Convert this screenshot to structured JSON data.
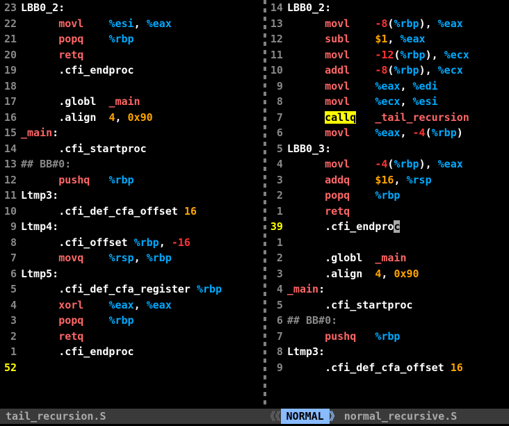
{
  "left": {
    "filename": "tail_recursion.S",
    "lines": [
      {
        "n": "23",
        "tokens": [
          {
            "cls": "c-label",
            "t": "LBB0_2:"
          }
        ]
      },
      {
        "n": "22",
        "tokens": [
          {
            "cls": "c-white",
            "t": "      "
          },
          {
            "cls": "c-op",
            "t": "movl"
          },
          {
            "cls": "c-white",
            "t": "    "
          },
          {
            "cls": "c-reg",
            "t": "%esi"
          },
          {
            "cls": "c-white",
            "t": ", "
          },
          {
            "cls": "c-reg",
            "t": "%eax"
          }
        ]
      },
      {
        "n": "21",
        "tokens": [
          {
            "cls": "c-white",
            "t": "      "
          },
          {
            "cls": "c-op",
            "t": "popq"
          },
          {
            "cls": "c-white",
            "t": "    "
          },
          {
            "cls": "c-reg",
            "t": "%rbp"
          }
        ]
      },
      {
        "n": "20",
        "tokens": [
          {
            "cls": "c-white",
            "t": "      "
          },
          {
            "cls": "c-op",
            "t": "retq"
          }
        ]
      },
      {
        "n": "19",
        "tokens": [
          {
            "cls": "c-white",
            "t": "      "
          },
          {
            "cls": "c-dir",
            "t": ".cfi_endproc"
          }
        ]
      },
      {
        "n": "18",
        "tokens": [
          {
            "cls": "c-white",
            "t": " "
          }
        ]
      },
      {
        "n": "17",
        "tokens": [
          {
            "cls": "c-white",
            "t": "      "
          },
          {
            "cls": "c-dir",
            "t": ".globl"
          },
          {
            "cls": "c-white",
            "t": "  "
          },
          {
            "cls": "c-sym",
            "t": "_main"
          }
        ]
      },
      {
        "n": "16",
        "tokens": [
          {
            "cls": "c-white",
            "t": "      "
          },
          {
            "cls": "c-dir",
            "t": ".align"
          },
          {
            "cls": "c-white",
            "t": "  "
          },
          {
            "cls": "c-num",
            "t": "4"
          },
          {
            "cls": "c-white",
            "t": ", "
          },
          {
            "cls": "c-num",
            "t": "0x90"
          }
        ]
      },
      {
        "n": "15",
        "tokens": [
          {
            "cls": "c-sym",
            "t": "_main"
          },
          {
            "cls": "c-white",
            "t": ":"
          }
        ]
      },
      {
        "n": "14",
        "tokens": [
          {
            "cls": "c-white",
            "t": "      "
          },
          {
            "cls": "c-dir",
            "t": ".cfi_startproc"
          }
        ]
      },
      {
        "n": "13",
        "tokens": [
          {
            "cls": "c-cmt",
            "t": "## BB#0:"
          }
        ]
      },
      {
        "n": "12",
        "tokens": [
          {
            "cls": "c-white",
            "t": "      "
          },
          {
            "cls": "c-op",
            "t": "pushq"
          },
          {
            "cls": "c-white",
            "t": "   "
          },
          {
            "cls": "c-reg",
            "t": "%rbp"
          }
        ]
      },
      {
        "n": "11",
        "tokens": [
          {
            "cls": "c-label",
            "t": "Ltmp3:"
          }
        ]
      },
      {
        "n": "10",
        "tokens": [
          {
            "cls": "c-white",
            "t": "      "
          },
          {
            "cls": "c-dir",
            "t": ".cfi_def_cfa_offset"
          },
          {
            "cls": "c-white",
            "t": " "
          },
          {
            "cls": "c-num",
            "t": "16"
          }
        ]
      },
      {
        "n": "9",
        "tokens": [
          {
            "cls": "c-label",
            "t": "Ltmp4:"
          }
        ]
      },
      {
        "n": "8",
        "tokens": [
          {
            "cls": "c-white",
            "t": "      "
          },
          {
            "cls": "c-dir",
            "t": ".cfi_offset"
          },
          {
            "cls": "c-white",
            "t": " "
          },
          {
            "cls": "c-reg",
            "t": "%rbp"
          },
          {
            "cls": "c-white",
            "t": ", "
          },
          {
            "cls": "c-num2",
            "t": "-16"
          }
        ]
      },
      {
        "n": "7",
        "tokens": [
          {
            "cls": "c-white",
            "t": "      "
          },
          {
            "cls": "c-op",
            "t": "movq"
          },
          {
            "cls": "c-white",
            "t": "    "
          },
          {
            "cls": "c-reg",
            "t": "%rsp"
          },
          {
            "cls": "c-white",
            "t": ", "
          },
          {
            "cls": "c-reg",
            "t": "%rbp"
          }
        ]
      },
      {
        "n": "6",
        "tokens": [
          {
            "cls": "c-label",
            "t": "Ltmp5:"
          }
        ]
      },
      {
        "n": "5",
        "tokens": [
          {
            "cls": "c-white",
            "t": "      "
          },
          {
            "cls": "c-dir",
            "t": ".cfi_def_cfa_register"
          },
          {
            "cls": "c-white",
            "t": " "
          },
          {
            "cls": "c-reg",
            "t": "%rbp"
          }
        ]
      },
      {
        "n": "4",
        "tokens": [
          {
            "cls": "c-white",
            "t": "      "
          },
          {
            "cls": "c-op",
            "t": "xorl"
          },
          {
            "cls": "c-white",
            "t": "    "
          },
          {
            "cls": "c-reg",
            "t": "%eax"
          },
          {
            "cls": "c-white",
            "t": ", "
          },
          {
            "cls": "c-reg",
            "t": "%eax"
          }
        ]
      },
      {
        "n": "3",
        "tokens": [
          {
            "cls": "c-white",
            "t": "      "
          },
          {
            "cls": "c-op",
            "t": "popq"
          },
          {
            "cls": "c-white",
            "t": "    "
          },
          {
            "cls": "c-reg",
            "t": "%rbp"
          }
        ]
      },
      {
        "n": "2",
        "tokens": [
          {
            "cls": "c-white",
            "t": "      "
          },
          {
            "cls": "c-op",
            "t": "retq"
          }
        ]
      },
      {
        "n": "1",
        "tokens": [
          {
            "cls": "c-white",
            "t": "      "
          },
          {
            "cls": "c-dir",
            "t": ".cfi_endproc"
          }
        ]
      },
      {
        "n": "52",
        "cur": true,
        "tokens": [
          {
            "cls": "c-white",
            "t": " "
          }
        ]
      }
    ]
  },
  "right": {
    "filename": "normal_recursive.S",
    "mode": "NORMAL",
    "lines": [
      {
        "n": "14",
        "tokens": [
          {
            "cls": "c-label",
            "t": "LBB0_2:"
          }
        ]
      },
      {
        "n": "13",
        "tokens": [
          {
            "cls": "c-white",
            "t": "      "
          },
          {
            "cls": "c-op",
            "t": "movl"
          },
          {
            "cls": "c-white",
            "t": "    "
          },
          {
            "cls": "c-num2",
            "t": "-8"
          },
          {
            "cls": "c-white",
            "t": "("
          },
          {
            "cls": "c-reg",
            "t": "%rbp"
          },
          {
            "cls": "c-white",
            "t": "), "
          },
          {
            "cls": "c-reg",
            "t": "%eax"
          }
        ]
      },
      {
        "n": "12",
        "tokens": [
          {
            "cls": "c-white",
            "t": "      "
          },
          {
            "cls": "c-op",
            "t": "subl"
          },
          {
            "cls": "c-white",
            "t": "    "
          },
          {
            "cls": "c-num",
            "t": "$1"
          },
          {
            "cls": "c-white",
            "t": ", "
          },
          {
            "cls": "c-reg",
            "t": "%eax"
          }
        ]
      },
      {
        "n": "11",
        "tokens": [
          {
            "cls": "c-white",
            "t": "      "
          },
          {
            "cls": "c-op",
            "t": "movl"
          },
          {
            "cls": "c-white",
            "t": "    "
          },
          {
            "cls": "c-num2",
            "t": "-12"
          },
          {
            "cls": "c-white",
            "t": "("
          },
          {
            "cls": "c-reg",
            "t": "%rbp"
          },
          {
            "cls": "c-white",
            "t": "), "
          },
          {
            "cls": "c-reg",
            "t": "%ecx"
          }
        ]
      },
      {
        "n": "10",
        "tokens": [
          {
            "cls": "c-white",
            "t": "      "
          },
          {
            "cls": "c-op",
            "t": "addl"
          },
          {
            "cls": "c-white",
            "t": "    "
          },
          {
            "cls": "c-num2",
            "t": "-8"
          },
          {
            "cls": "c-white",
            "t": "("
          },
          {
            "cls": "c-reg",
            "t": "%rbp"
          },
          {
            "cls": "c-white",
            "t": "), "
          },
          {
            "cls": "c-reg",
            "t": "%ecx"
          }
        ]
      },
      {
        "n": "9",
        "tokens": [
          {
            "cls": "c-white",
            "t": "      "
          },
          {
            "cls": "c-op",
            "t": "movl"
          },
          {
            "cls": "c-white",
            "t": "    "
          },
          {
            "cls": "c-reg",
            "t": "%eax"
          },
          {
            "cls": "c-white",
            "t": ", "
          },
          {
            "cls": "c-reg",
            "t": "%edi"
          }
        ]
      },
      {
        "n": "8",
        "tokens": [
          {
            "cls": "c-white",
            "t": "      "
          },
          {
            "cls": "c-op",
            "t": "movl"
          },
          {
            "cls": "c-white",
            "t": "    "
          },
          {
            "cls": "c-reg",
            "t": "%ecx"
          },
          {
            "cls": "c-white",
            "t": ", "
          },
          {
            "cls": "c-reg",
            "t": "%esi"
          }
        ]
      },
      {
        "n": "7",
        "tokens": [
          {
            "cls": "c-white",
            "t": "      "
          },
          {
            "cls": "hl-call",
            "t": "callq"
          },
          {
            "cls": "c-white",
            "t": "   "
          },
          {
            "cls": "c-sym",
            "t": "_tail_recursion"
          }
        ]
      },
      {
        "n": "6",
        "tokens": [
          {
            "cls": "c-white",
            "t": "      "
          },
          {
            "cls": "c-op",
            "t": "movl"
          },
          {
            "cls": "c-white",
            "t": "    "
          },
          {
            "cls": "c-reg",
            "t": "%eax"
          },
          {
            "cls": "c-white",
            "t": ", "
          },
          {
            "cls": "c-num2",
            "t": "-4"
          },
          {
            "cls": "c-white",
            "t": "("
          },
          {
            "cls": "c-reg",
            "t": "%rbp"
          },
          {
            "cls": "c-white",
            "t": ")"
          }
        ]
      },
      {
        "n": "5",
        "tokens": [
          {
            "cls": "c-label",
            "t": "LBB0_3:"
          }
        ]
      },
      {
        "n": "4",
        "tokens": [
          {
            "cls": "c-white",
            "t": "      "
          },
          {
            "cls": "c-op",
            "t": "movl"
          },
          {
            "cls": "c-white",
            "t": "    "
          },
          {
            "cls": "c-num2",
            "t": "-4"
          },
          {
            "cls": "c-white",
            "t": "("
          },
          {
            "cls": "c-reg",
            "t": "%rbp"
          },
          {
            "cls": "c-white",
            "t": "), "
          },
          {
            "cls": "c-reg",
            "t": "%eax"
          }
        ]
      },
      {
        "n": "3",
        "tokens": [
          {
            "cls": "c-white",
            "t": "      "
          },
          {
            "cls": "c-op",
            "t": "addq"
          },
          {
            "cls": "c-white",
            "t": "    "
          },
          {
            "cls": "c-num",
            "t": "$16"
          },
          {
            "cls": "c-white",
            "t": ", "
          },
          {
            "cls": "c-reg",
            "t": "%rsp"
          }
        ]
      },
      {
        "n": "2",
        "tokens": [
          {
            "cls": "c-white",
            "t": "      "
          },
          {
            "cls": "c-op",
            "t": "popq"
          },
          {
            "cls": "c-white",
            "t": "    "
          },
          {
            "cls": "c-reg",
            "t": "%rbp"
          }
        ]
      },
      {
        "n": "1",
        "tokens": [
          {
            "cls": "c-white",
            "t": "      "
          },
          {
            "cls": "c-op",
            "t": "retq"
          }
        ]
      },
      {
        "n": "39",
        "cur": true,
        "tokens": [
          {
            "cls": "c-white",
            "t": "      "
          },
          {
            "cls": "c-dir",
            "t": ".cfi_endpro"
          },
          {
            "cls": "cursor-block",
            "t": "c"
          }
        ]
      },
      {
        "n": "1",
        "tokens": [
          {
            "cls": "c-white",
            "t": " "
          }
        ]
      },
      {
        "n": "2",
        "tokens": [
          {
            "cls": "c-white",
            "t": "      "
          },
          {
            "cls": "c-dir",
            "t": ".globl"
          },
          {
            "cls": "c-white",
            "t": "  "
          },
          {
            "cls": "c-sym",
            "t": "_main"
          }
        ]
      },
      {
        "n": "3",
        "tokens": [
          {
            "cls": "c-white",
            "t": "      "
          },
          {
            "cls": "c-dir",
            "t": ".align"
          },
          {
            "cls": "c-white",
            "t": "  "
          },
          {
            "cls": "c-num",
            "t": "4"
          },
          {
            "cls": "c-white",
            "t": ", "
          },
          {
            "cls": "c-num",
            "t": "0x90"
          }
        ]
      },
      {
        "n": "4",
        "tokens": [
          {
            "cls": "c-sym",
            "t": "_main"
          },
          {
            "cls": "c-white",
            "t": ":"
          }
        ]
      },
      {
        "n": "5",
        "tokens": [
          {
            "cls": "c-white",
            "t": "      "
          },
          {
            "cls": "c-dir",
            "t": ".cfi_startproc"
          }
        ]
      },
      {
        "n": "6",
        "tokens": [
          {
            "cls": "c-cmt",
            "t": "## BB#0:"
          }
        ]
      },
      {
        "n": "7",
        "tokens": [
          {
            "cls": "c-white",
            "t": "      "
          },
          {
            "cls": "c-op",
            "t": "pushq"
          },
          {
            "cls": "c-white",
            "t": "   "
          },
          {
            "cls": "c-reg",
            "t": "%rbp"
          }
        ]
      },
      {
        "n": "8",
        "tokens": [
          {
            "cls": "c-label",
            "t": "Ltmp3:"
          }
        ]
      },
      {
        "n": "9",
        "tokens": [
          {
            "cls": "c-white",
            "t": "      "
          },
          {
            "cls": "c-dir",
            "t": ".cfi_def_cfa_offset"
          },
          {
            "cls": "c-white",
            "t": " "
          },
          {
            "cls": "c-num",
            "t": "16"
          }
        ]
      }
    ]
  },
  "statusbar": {
    "arrows": "《《",
    "sep_right": "》"
  }
}
